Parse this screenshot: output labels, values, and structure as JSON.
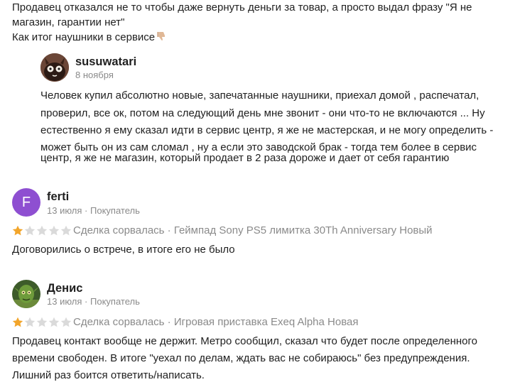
{
  "reply_block": {
    "text_line1": "Продавец отказался не то чтобы даже вернуть деньги за товар, а просто выдал фразу \"Я не",
    "text_line2": "магазин, гарантии нет\"",
    "text_line3": "Как итог наушники в сервисе"
  },
  "seller_reply": {
    "author": "susuwatari",
    "date": "8 ноября",
    "lines": [
      "Человек купил абсолютно новые, запечатанные наушники, приехал домой , распечатал,",
      "проверил, все ок, потом на следующий день мне звонит - они что-то не включаются ... Ну",
      "естественно я ему сказал идти в сервис центр, я же не мастерская, и не могу определить -",
      "может быть он из сам сломал , ну а если это заводской брак - тогда тем более в сервис",
      "центр, я же не магазин, который продает в 2 раза дороже и дает от себя гарантию"
    ]
  },
  "reviews": [
    {
      "author": "ferti",
      "avatar_letter": "F",
      "date": "13 июля",
      "role": "Покупатель",
      "rating": 1,
      "deal_status": "Сделка сорвалась",
      "item": "Геймпад Sony PS5 лимитка 30Th Anniversary Новый",
      "lines": [
        "Договорились о встрече, в итоге его не было"
      ]
    },
    {
      "author": "Денис",
      "date": "13 июля",
      "role": "Покупатель",
      "rating": 1,
      "deal_status": "Сделка сорвалась",
      "item": "Игровая приставка Exeq Alpha Новая",
      "lines": [
        "Продавец контакт вообще не держит. Метро сообщил, сказал что будет после определенного",
        "времени свободен. В итоге \"уехал по делам, ждать вас не собираюсь\" без предупреждения.",
        "Лишний раз боится ответить/написать."
      ]
    }
  ],
  "colors": {
    "star_filled": "#f2a52b",
    "star_empty": "#dadada",
    "avatar_ferti": "#8e4fd1",
    "meta_text": "#8a8a8a"
  },
  "icons": {
    "thumb": "thumbs-down-icon",
    "star": "star-icon"
  }
}
